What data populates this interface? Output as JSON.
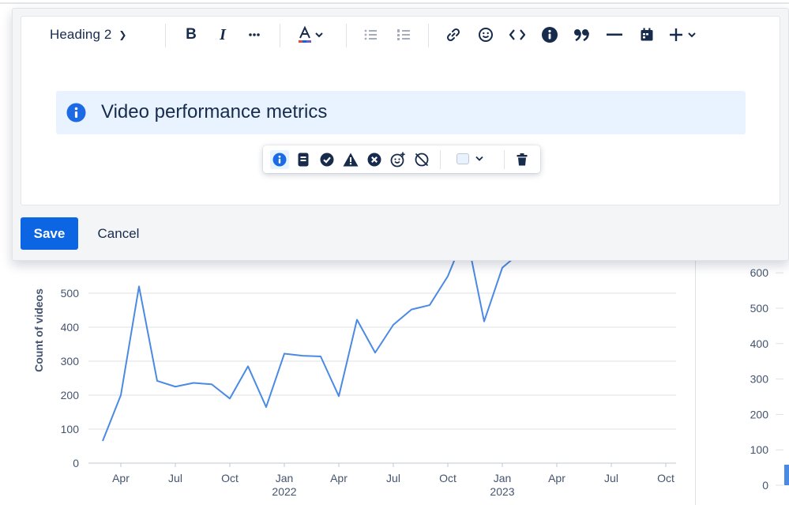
{
  "editor": {
    "heading_select": "Heading 2",
    "panel_text": "Video performance metrics",
    "save_label": "Save",
    "cancel_label": "Cancel",
    "toolbar_icons": [
      "bold-icon",
      "italic-icon",
      "more-icon",
      "text-color-icon",
      "bullet-list-icon",
      "numbered-list-icon",
      "link-icon",
      "emoji-icon",
      "code-icon",
      "info-icon",
      "quote-icon",
      "divider-icon",
      "date-icon",
      "insert-icon"
    ],
    "panel_toolbar_icons": [
      "info-panel-icon",
      "note-panel-icon",
      "success-panel-icon",
      "warning-panel-icon",
      "error-panel-icon",
      "custom-emoji-icon",
      "remove-emoji-icon",
      "panel-color-icon",
      "delete-icon"
    ],
    "panel_color": "#e9f2ff",
    "accent_color": "#0c66e4"
  },
  "chart_data": [
    {
      "type": "line",
      "ylabel": "Count of videos",
      "ylim": [
        0,
        600
      ],
      "yticks": [
        "0",
        "100",
        "200",
        "300",
        "400",
        "500"
      ],
      "xticks": [
        {
          "label": "Apr",
          "sub": "",
          "x": "2021-04-01"
        },
        {
          "label": "Jul",
          "sub": "",
          "x": "2021-07-01"
        },
        {
          "label": "Oct",
          "sub": "",
          "x": "2021-10-01"
        },
        {
          "label": "Jan",
          "sub": "2022",
          "x": "2022-01-01"
        },
        {
          "label": "Apr",
          "sub": "",
          "x": "2022-04-01"
        },
        {
          "label": "Jul",
          "sub": "",
          "x": "2022-07-01"
        },
        {
          "label": "Oct",
          "sub": "",
          "x": "2022-10-01"
        },
        {
          "label": "Jan",
          "sub": "2023",
          "x": "2023-01-01"
        },
        {
          "label": "Apr",
          "sub": "",
          "x": "2023-04-01"
        },
        {
          "label": "Jul",
          "sub": "",
          "x": "2023-07-01"
        },
        {
          "label": "Oct",
          "sub": "",
          "x": "2023-10-01"
        }
      ],
      "series": [
        {
          "color": "#4b8ae4",
          "points": [
            {
              "x": "2021-03-01",
              "y": 65
            },
            {
              "x": "2021-04-01",
              "y": 200
            },
            {
              "x": "2021-05-01",
              "y": 520
            },
            {
              "x": "2021-06-01",
              "y": 242
            },
            {
              "x": "2021-07-01",
              "y": 225
            },
            {
              "x": "2021-08-01",
              "y": 236
            },
            {
              "x": "2021-09-01",
              "y": 232
            },
            {
              "x": "2021-10-01",
              "y": 190
            },
            {
              "x": "2021-11-01",
              "y": 285
            },
            {
              "x": "2021-12-01",
              "y": 165
            },
            {
              "x": "2022-01-01",
              "y": 322
            },
            {
              "x": "2022-02-01",
              "y": 316
            },
            {
              "x": "2022-03-01",
              "y": 314
            },
            {
              "x": "2022-04-01",
              "y": 197
            },
            {
              "x": "2022-05-01",
              "y": 422
            },
            {
              "x": "2022-06-01",
              "y": 325
            },
            {
              "x": "2022-07-01",
              "y": 407
            },
            {
              "x": "2022-08-01",
              "y": 452
            },
            {
              "x": "2022-09-01",
              "y": 465
            },
            {
              "x": "2022-10-01",
              "y": 550
            },
            {
              "x": "2022-11-01",
              "y": 680
            },
            {
              "x": "2022-12-01",
              "y": 417
            },
            {
              "x": "2023-01-01",
              "y": 575
            },
            {
              "x": "2023-02-01",
              "y": 620
            }
          ]
        }
      ]
    },
    {
      "type": "bar",
      "ylim": [
        0,
        600
      ],
      "yticks": [
        "0",
        "100",
        "200",
        "300",
        "400",
        "500",
        "600"
      ],
      "bar_color": "#4b8ae4"
    }
  ]
}
